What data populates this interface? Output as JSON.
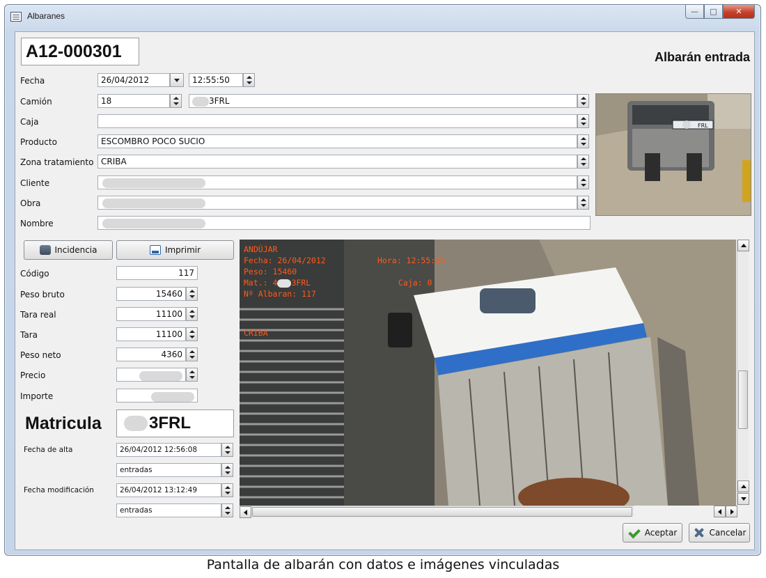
{
  "window": {
    "title": "Albaranes",
    "controls": {
      "minimize": "—",
      "maximize": "□",
      "close": "✕"
    }
  },
  "header": {
    "document_number": "A12-000301",
    "document_type": "Albarán entrada"
  },
  "form": {
    "fecha": {
      "label": "Fecha",
      "date": "26/04/2012",
      "time": "12:55:50"
    },
    "camion": {
      "label": "Camión",
      "number": "18",
      "plate_suffix": "3FRL"
    },
    "caja": {
      "label": "Caja",
      "value": ""
    },
    "producto": {
      "label": "Producto",
      "value": "ESCOMBRO POCO SUCIO"
    },
    "zona": {
      "label": "Zona tratamiento",
      "value": "CRIBA"
    },
    "cliente": {
      "label": "Cliente",
      "value": ""
    },
    "obra": {
      "label": "Obra",
      "value": ""
    },
    "nombre": {
      "label": "Nombre",
      "value": ""
    }
  },
  "buttons": {
    "incidencia": "Incidencia",
    "imprimir": "Imprimir",
    "aceptar": "Aceptar",
    "cancelar": "Cancelar"
  },
  "weights": {
    "codigo": {
      "label": "Código",
      "value": "117"
    },
    "peso_bruto": {
      "label": "Peso bruto",
      "value": "15460"
    },
    "tara_real": {
      "label": "Tara real",
      "value": "11100"
    },
    "tara": {
      "label": "Tara",
      "value": "11100"
    },
    "peso_neto": {
      "label": "Peso neto",
      "value": "4360"
    },
    "precio": {
      "label": "Precio",
      "value": ""
    },
    "importe": {
      "label": "Importe",
      "value": ""
    }
  },
  "matricula": {
    "label": "Matricula",
    "value_suffix": "3FRL"
  },
  "audit": {
    "alta_label": "Fecha de alta",
    "alta_value": "26/04/2012 12:56:08",
    "alta_user": "entradas",
    "mod_label": "Fecha modificación",
    "mod_value": "26/04/2012 13:12:49",
    "mod_user": "entradas"
  },
  "camera_overlay": {
    "place": "ANDÚJAR",
    "fecha": "Fecha: 26/04/2012",
    "hora": "Hora: 12:55:50",
    "peso": "Peso: 15460",
    "mat_prefix": "Mat.: 4",
    "mat_suffix": "3FRL",
    "caja": "Caja: 0",
    "albaran": "Nº Albaran: 117",
    "zona": "CRIBA"
  },
  "thumb_plate_suffix": "FRL",
  "caption": "Pantalla de albarán con datos e imágenes vinculadas",
  "colors": {
    "overlay_text": "#ff5a1a",
    "close_button": "#c4412b"
  }
}
